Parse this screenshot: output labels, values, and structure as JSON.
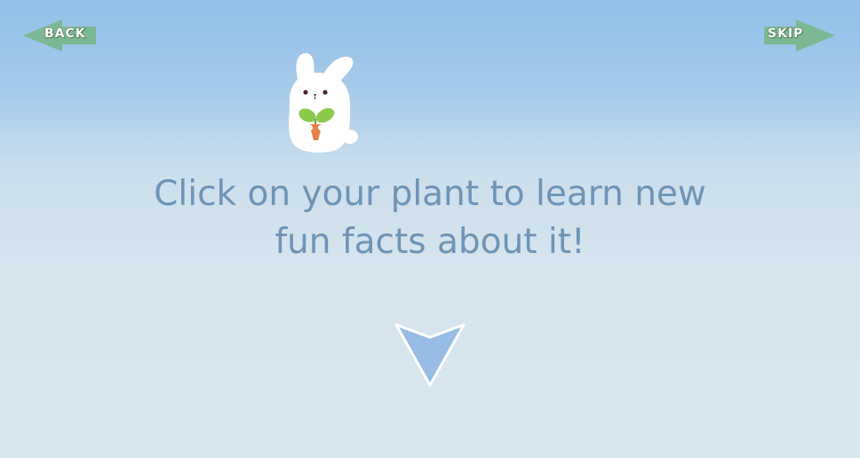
{
  "nav": {
    "back_label": "BACK",
    "skip_label": "SKIP"
  },
  "mascot": {
    "icon": "bunny-holding-sprout-icon"
  },
  "instruction": {
    "line1": "Click on your plant to learn new",
    "line2": "fun facts about it!"
  },
  "continue": {
    "icon": "down-arrow-icon"
  },
  "colors": {
    "sky_top": "#92c0e8",
    "sky_bottom": "#d9e7ef",
    "nav_arrow": "#7bb893",
    "text": "#6e94b6",
    "down_arrow": "#98bde4"
  }
}
